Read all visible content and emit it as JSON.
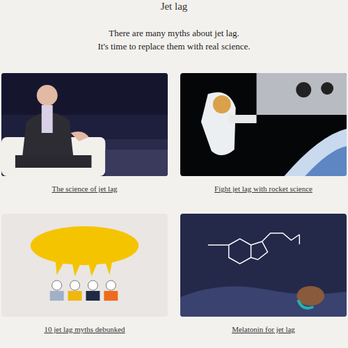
{
  "page": {
    "title": "Jet lag",
    "intro": [
      "There are many myths about jet lag.",
      "It's time to replace them with real science."
    ]
  },
  "cards": [
    {
      "caption": "The science of jet lag",
      "kind": "speaker"
    },
    {
      "caption": "Fight jet lag with rocket science",
      "kind": "astronaut"
    },
    {
      "caption": "10 jet lag myths debunked",
      "kind": "bubble"
    },
    {
      "caption": "Melatonin for jet lag",
      "kind": "molecule"
    }
  ]
}
